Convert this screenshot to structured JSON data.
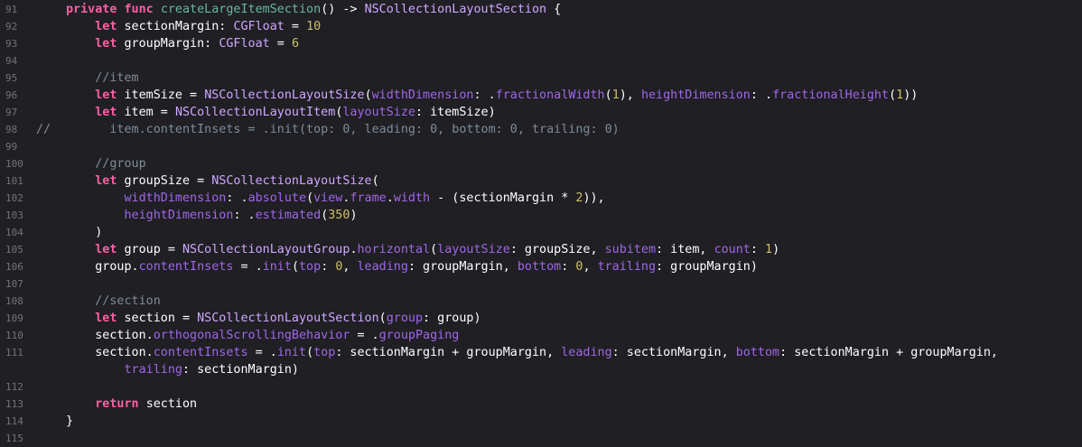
{
  "editor": {
    "first_line_number": 91,
    "colors": {
      "background": "#1f1f24",
      "line_number": "#747478",
      "plain": "#ffffff",
      "keyword": "#fc5fa3",
      "function_declaration": "#67b7a4",
      "type": "#d0a8ff",
      "number": "#d0bf69",
      "comment": "#7f8c98",
      "property": "#a167e6"
    },
    "lines": [
      {
        "number": "91",
        "gutter": "",
        "tokens": [
          [
            "keyword",
            "private func "
          ],
          [
            "funcDecl",
            "createLargeItemSection"
          ],
          [
            "plain",
            "() -> "
          ],
          [
            "type",
            "NSCollectionLayoutSection"
          ],
          [
            "plain",
            " {"
          ]
        ]
      },
      {
        "number": "92",
        "gutter": "",
        "tokens": [
          [
            "plain",
            "    "
          ],
          [
            "keyword",
            "let "
          ],
          [
            "plain",
            "sectionMargin: "
          ],
          [
            "type",
            "CGFloat"
          ],
          [
            "plain",
            " = "
          ],
          [
            "number",
            "10"
          ]
        ]
      },
      {
        "number": "93",
        "gutter": "",
        "tokens": [
          [
            "plain",
            "    "
          ],
          [
            "keyword",
            "let "
          ],
          [
            "plain",
            "groupMargin: "
          ],
          [
            "type",
            "CGFloat"
          ],
          [
            "plain",
            " = "
          ],
          [
            "number",
            "6"
          ]
        ]
      },
      {
        "number": "94",
        "gutter": "",
        "tokens": []
      },
      {
        "number": "95",
        "gutter": "",
        "tokens": [
          [
            "plain",
            "    "
          ],
          [
            "comment",
            "//item"
          ]
        ]
      },
      {
        "number": "96",
        "gutter": "",
        "tokens": [
          [
            "plain",
            "    "
          ],
          [
            "keyword",
            "let "
          ],
          [
            "plain",
            "itemSize = "
          ],
          [
            "type",
            "NSCollectionLayoutSize"
          ],
          [
            "plain",
            "("
          ],
          [
            "prop",
            "widthDimension"
          ],
          [
            "plain",
            ": ."
          ],
          [
            "prop",
            "fractionalWidth"
          ],
          [
            "plain",
            "("
          ],
          [
            "number",
            "1"
          ],
          [
            "plain",
            "), "
          ],
          [
            "prop",
            "heightDimension"
          ],
          [
            "plain",
            ": ."
          ],
          [
            "prop",
            "fractionalHeight"
          ],
          [
            "plain",
            "("
          ],
          [
            "number",
            "1"
          ],
          [
            "plain",
            "))"
          ]
        ]
      },
      {
        "number": "97",
        "gutter": "",
        "tokens": [
          [
            "plain",
            "    "
          ],
          [
            "keyword",
            "let "
          ],
          [
            "plain",
            "item = "
          ],
          [
            "type",
            "NSCollectionLayoutItem"
          ],
          [
            "plain",
            "("
          ],
          [
            "prop",
            "layoutSize"
          ],
          [
            "plain",
            ": itemSize)"
          ]
        ]
      },
      {
        "number": "98",
        "gutter": "//",
        "tokens": [
          [
            "comment",
            "      item.contentInsets = .init(top: 0, leading: 0, bottom: 0, trailing: 0)"
          ]
        ]
      },
      {
        "number": "99",
        "gutter": "",
        "tokens": []
      },
      {
        "number": "100",
        "gutter": "",
        "tokens": [
          [
            "plain",
            "    "
          ],
          [
            "comment",
            "//group"
          ]
        ]
      },
      {
        "number": "101",
        "gutter": "",
        "tokens": [
          [
            "plain",
            "    "
          ],
          [
            "keyword",
            "let "
          ],
          [
            "plain",
            "groupSize = "
          ],
          [
            "type",
            "NSCollectionLayoutSize"
          ],
          [
            "plain",
            "("
          ]
        ]
      },
      {
        "number": "102",
        "gutter": "",
        "tokens": [
          [
            "plain",
            "        "
          ],
          [
            "prop",
            "widthDimension"
          ],
          [
            "plain",
            ": ."
          ],
          [
            "prop",
            "absolute"
          ],
          [
            "plain",
            "("
          ],
          [
            "prop",
            "view"
          ],
          [
            "plain",
            "."
          ],
          [
            "prop",
            "frame"
          ],
          [
            "plain",
            "."
          ],
          [
            "prop",
            "width"
          ],
          [
            "plain",
            " - (sectionMargin * "
          ],
          [
            "number",
            "2"
          ],
          [
            "plain",
            ")),"
          ]
        ]
      },
      {
        "number": "103",
        "gutter": "",
        "tokens": [
          [
            "plain",
            "        "
          ],
          [
            "prop",
            "heightDimension"
          ],
          [
            "plain",
            ": ."
          ],
          [
            "prop",
            "estimated"
          ],
          [
            "plain",
            "("
          ],
          [
            "number",
            "350"
          ],
          [
            "plain",
            ")"
          ]
        ]
      },
      {
        "number": "104",
        "gutter": "",
        "tokens": [
          [
            "plain",
            "    )"
          ]
        ]
      },
      {
        "number": "105",
        "gutter": "",
        "tokens": [
          [
            "plain",
            "    "
          ],
          [
            "keyword",
            "let "
          ],
          [
            "plain",
            "group = "
          ],
          [
            "type",
            "NSCollectionLayoutGroup"
          ],
          [
            "plain",
            "."
          ],
          [
            "prop",
            "horizontal"
          ],
          [
            "plain",
            "("
          ],
          [
            "prop",
            "layoutSize"
          ],
          [
            "plain",
            ": groupSize, "
          ],
          [
            "prop",
            "subitem"
          ],
          [
            "plain",
            ": item, "
          ],
          [
            "prop",
            "count"
          ],
          [
            "plain",
            ": "
          ],
          [
            "number",
            "1"
          ],
          [
            "plain",
            ")"
          ]
        ]
      },
      {
        "number": "106",
        "gutter": "",
        "tokens": [
          [
            "plain",
            "    group."
          ],
          [
            "prop",
            "contentInsets"
          ],
          [
            "plain",
            " = ."
          ],
          [
            "prop",
            "init"
          ],
          [
            "plain",
            "("
          ],
          [
            "prop",
            "top"
          ],
          [
            "plain",
            ": "
          ],
          [
            "number",
            "0"
          ],
          [
            "plain",
            ", "
          ],
          [
            "prop",
            "leading"
          ],
          [
            "plain",
            ": groupMargin, "
          ],
          [
            "prop",
            "bottom"
          ],
          [
            "plain",
            ": "
          ],
          [
            "number",
            "0"
          ],
          [
            "plain",
            ", "
          ],
          [
            "prop",
            "trailing"
          ],
          [
            "plain",
            ": groupMargin)"
          ]
        ]
      },
      {
        "number": "107",
        "gutter": "",
        "tokens": []
      },
      {
        "number": "108",
        "gutter": "",
        "tokens": [
          [
            "plain",
            "    "
          ],
          [
            "comment",
            "//section"
          ]
        ]
      },
      {
        "number": "109",
        "gutter": "",
        "tokens": [
          [
            "plain",
            "    "
          ],
          [
            "keyword",
            "let "
          ],
          [
            "plain",
            "section = "
          ],
          [
            "type",
            "NSCollectionLayoutSection"
          ],
          [
            "plain",
            "("
          ],
          [
            "prop",
            "group"
          ],
          [
            "plain",
            ": group)"
          ]
        ]
      },
      {
        "number": "110",
        "gutter": "",
        "tokens": [
          [
            "plain",
            "    section."
          ],
          [
            "prop",
            "orthogonalScrollingBehavior"
          ],
          [
            "plain",
            " = ."
          ],
          [
            "prop",
            "groupPaging"
          ]
        ]
      },
      {
        "number": "111",
        "gutter": "",
        "tokens": [
          [
            "plain",
            "    section."
          ],
          [
            "prop",
            "contentInsets"
          ],
          [
            "plain",
            " = ."
          ],
          [
            "prop",
            "init"
          ],
          [
            "plain",
            "("
          ],
          [
            "prop",
            "top"
          ],
          [
            "plain",
            ": sectionMargin + groupMargin, "
          ],
          [
            "prop",
            "leading"
          ],
          [
            "plain",
            ": sectionMargin, "
          ],
          [
            "prop",
            "bottom"
          ],
          [
            "plain",
            ": sectionMargin + groupMargin,"
          ]
        ]
      },
      {
        "number": "",
        "gutter": "",
        "tokens": [
          [
            "plain",
            "        "
          ],
          [
            "prop",
            "trailing"
          ],
          [
            "plain",
            ": sectionMargin)"
          ]
        ]
      },
      {
        "number": "112",
        "gutter": "",
        "tokens": []
      },
      {
        "number": "113",
        "gutter": "",
        "tokens": [
          [
            "plain",
            "    "
          ],
          [
            "keyword",
            "return "
          ],
          [
            "plain",
            "section"
          ]
        ]
      },
      {
        "number": "114",
        "gutter": "",
        "tokens": [
          [
            "plain",
            "}"
          ]
        ]
      },
      {
        "number": "115",
        "gutter": "",
        "tokens": []
      }
    ]
  }
}
